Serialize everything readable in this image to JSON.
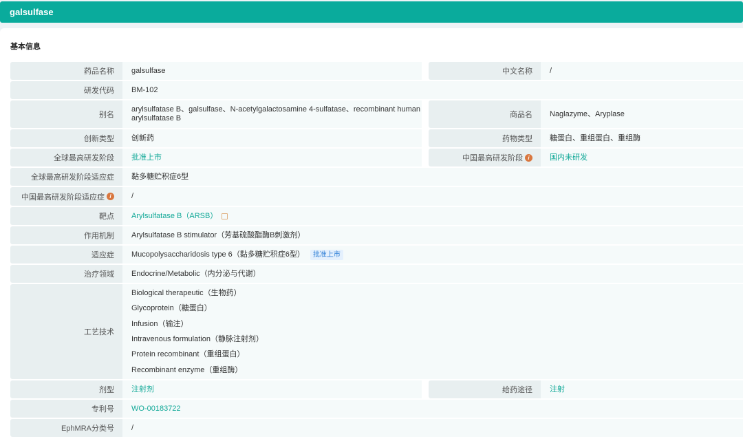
{
  "header": {
    "title": "galsulfase"
  },
  "section_title": "基本信息",
  "rows": [
    {
      "label": "药品名称",
      "value": "galsulfase",
      "right": {
        "label": "中文名称",
        "value": "/"
      }
    },
    {
      "label": "研发代码",
      "value": "BM-102"
    },
    {
      "label": "别名",
      "value": "arylsulfatase B、galsulfase、N-acetylgalactosamine 4-sulfatase、recombinant human arylsulfatase B",
      "right": {
        "label": "商品名",
        "value": "Naglazyme、Aryplase"
      }
    },
    {
      "label": "创新类型",
      "value": "创新药",
      "right": {
        "label": "药物类型",
        "value": "糖蛋白、重组蛋白、重组酶"
      }
    },
    {
      "label": "全球最高研发阶段",
      "value": "批准上市",
      "link": true,
      "right": {
        "label": "中国最高研发阶段",
        "value": "国内未研发",
        "link": true,
        "info": true
      }
    },
    {
      "label": "全球最高研发阶段适应症",
      "value": "黏多糖贮积症6型"
    },
    {
      "label": "中国最高研发阶段适应症",
      "value": "/",
      "info": true
    },
    {
      "label": "靶点",
      "value": "Arylsulfatase B（ARSB）",
      "link": true,
      "ext": true
    },
    {
      "label": "作用机制",
      "value": "Arylsulfatase B stimulator（芳基硫酸酯酶B刺激剂）"
    },
    {
      "label": "适应症",
      "value": "Mucopolysaccharidosis type 6（黏多糖贮积症6型）",
      "badge": "批准上市"
    },
    {
      "label": "治疗领域",
      "value": "Endocrine/Metabolic（内分泌与代谢）"
    },
    {
      "label": "工艺技术",
      "values": [
        "Biological therapeutic（生物药）",
        "Glycoprotein（糖蛋白）",
        "Infusion（输注）",
        "Intravenous formulation（静脉注射剂）",
        "Protein recombinant（重组蛋白）",
        "Recombinant enzyme（重组酶）"
      ]
    },
    {
      "label": "剂型",
      "value": "注射剂",
      "link": true,
      "right": {
        "label": "给药途径",
        "value": "注射",
        "link": true
      }
    },
    {
      "label": "专利号",
      "value": "WO-00183722",
      "link": true
    },
    {
      "label": "EphMRA分类号",
      "value": "/"
    }
  ],
  "colors": {
    "brand": "#0aab9c",
    "link": "#10a897",
    "info": "#d9773f"
  }
}
